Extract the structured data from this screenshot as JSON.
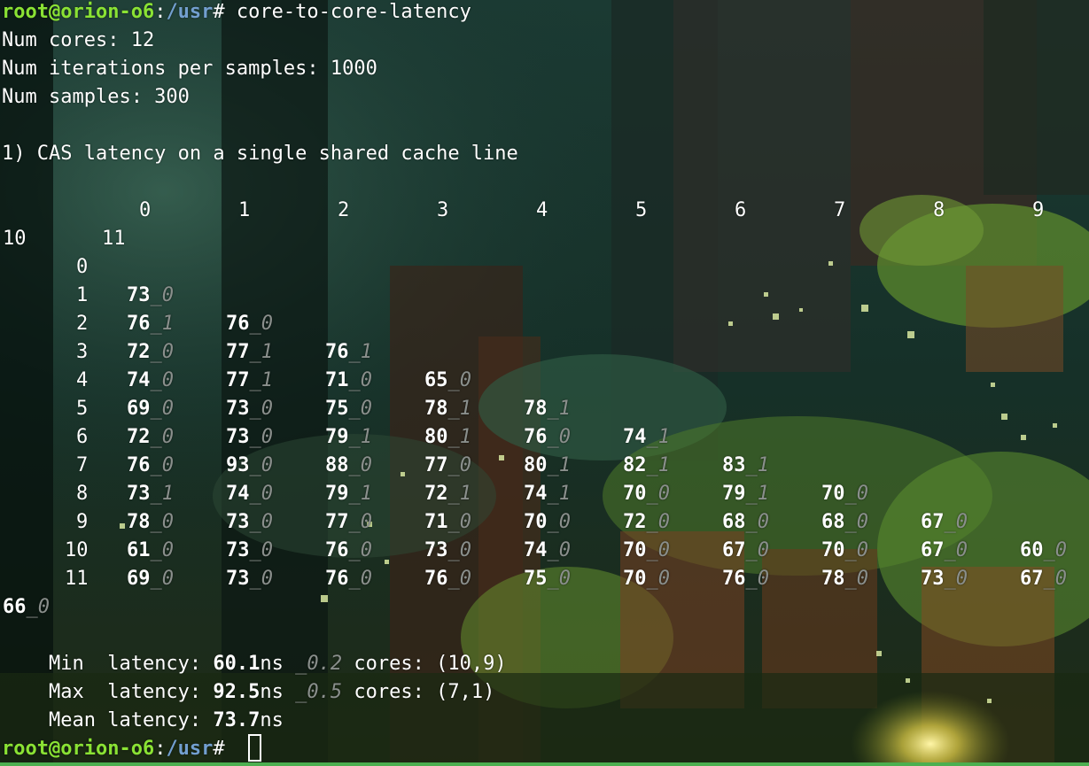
{
  "prompt": {
    "user": "root@orion-o6",
    "sep": ":",
    "path": "/usr",
    "hash": "#"
  },
  "command": "core-to-core-latency",
  "info_lines": [
    "Num cores: 12",
    "Num iterations per samples: 1000",
    "Num samples: 300"
  ],
  "section_title": "1) CAS latency on a single shared cache line",
  "col_headers": [
    "0",
    "1",
    "2",
    "3",
    "4",
    "5",
    "6",
    "7",
    "8",
    "9",
    "10",
    "11"
  ],
  "row_labels": [
    "0",
    "1",
    "2",
    "3",
    "4",
    "5",
    "6",
    "7",
    "8",
    "9",
    "10",
    "11"
  ],
  "matrix": [
    [],
    [
      [
        "73",
        "_0"
      ]
    ],
    [
      [
        "76",
        "_1"
      ],
      [
        "76",
        "_0"
      ]
    ],
    [
      [
        "72",
        "_0"
      ],
      [
        "77",
        "_1"
      ],
      [
        "76",
        "_1"
      ]
    ],
    [
      [
        "74",
        "_0"
      ],
      [
        "77",
        "_1"
      ],
      [
        "71",
        "_0"
      ],
      [
        "65",
        "_0"
      ]
    ],
    [
      [
        "69",
        "_0"
      ],
      [
        "73",
        "_0"
      ],
      [
        "75",
        "_0"
      ],
      [
        "78",
        "_1"
      ],
      [
        "78",
        "_1"
      ]
    ],
    [
      [
        "72",
        "_0"
      ],
      [
        "73",
        "_0"
      ],
      [
        "79",
        "_1"
      ],
      [
        "80",
        "_1"
      ],
      [
        "76",
        "_0"
      ],
      [
        "74",
        "_1"
      ]
    ],
    [
      [
        "76",
        "_0"
      ],
      [
        "93",
        "_0"
      ],
      [
        "88",
        "_0"
      ],
      [
        "77",
        "_0"
      ],
      [
        "80",
        "_1"
      ],
      [
        "82",
        "_1"
      ],
      [
        "83",
        "_1"
      ]
    ],
    [
      [
        "73",
        "_1"
      ],
      [
        "74",
        "_0"
      ],
      [
        "79",
        "_1"
      ],
      [
        "72",
        "_1"
      ],
      [
        "74",
        "_1"
      ],
      [
        "70",
        "_0"
      ],
      [
        "79",
        "_1"
      ],
      [
        "70",
        "_0"
      ]
    ],
    [
      [
        "78",
        "_0"
      ],
      [
        "73",
        "_0"
      ],
      [
        "77",
        "_0"
      ],
      [
        "71",
        "_0"
      ],
      [
        "70",
        "_0"
      ],
      [
        "72",
        "_0"
      ],
      [
        "68",
        "_0"
      ],
      [
        "68",
        "_0"
      ],
      [
        "67",
        "_0"
      ]
    ],
    [
      [
        "61",
        "_0"
      ],
      [
        "73",
        "_0"
      ],
      [
        "76",
        "_0"
      ],
      [
        "73",
        "_0"
      ],
      [
        "74",
        "_0"
      ],
      [
        "70",
        "_0"
      ],
      [
        "67",
        "_0"
      ],
      [
        "70",
        "_0"
      ],
      [
        "67",
        "_0"
      ],
      [
        "60",
        "_0"
      ]
    ],
    [
      [
        "69",
        "_0"
      ],
      [
        "73",
        "_0"
      ],
      [
        "76",
        "_0"
      ],
      [
        "76",
        "_0"
      ],
      [
        "75",
        "_0"
      ],
      [
        "70",
        "_0"
      ],
      [
        "76",
        "_0"
      ],
      [
        "78",
        "_0"
      ],
      [
        "73",
        "_0"
      ],
      [
        "67",
        "_0"
      ],
      [
        "66",
        "_0"
      ]
    ]
  ],
  "stats": {
    "min": {
      "label": "Min  latency: ",
      "value": "60.1",
      "unit": "ns ",
      "dev": "_0.2",
      "cores": " cores: (10,9)"
    },
    "max": {
      "label": "Max  latency: ",
      "value": "92.5",
      "unit": "ns ",
      "dev": "_0.5",
      "cores": " cores: (7,1)"
    },
    "mean": {
      "label": "Mean latency: ",
      "value": "73.7",
      "unit": "ns"
    }
  },
  "colors": {
    "prompt_user": "#8ae234",
    "prompt_path": "#729fcf",
    "dim": "#8a8f8c",
    "bottom_bar": "#4caf50"
  }
}
